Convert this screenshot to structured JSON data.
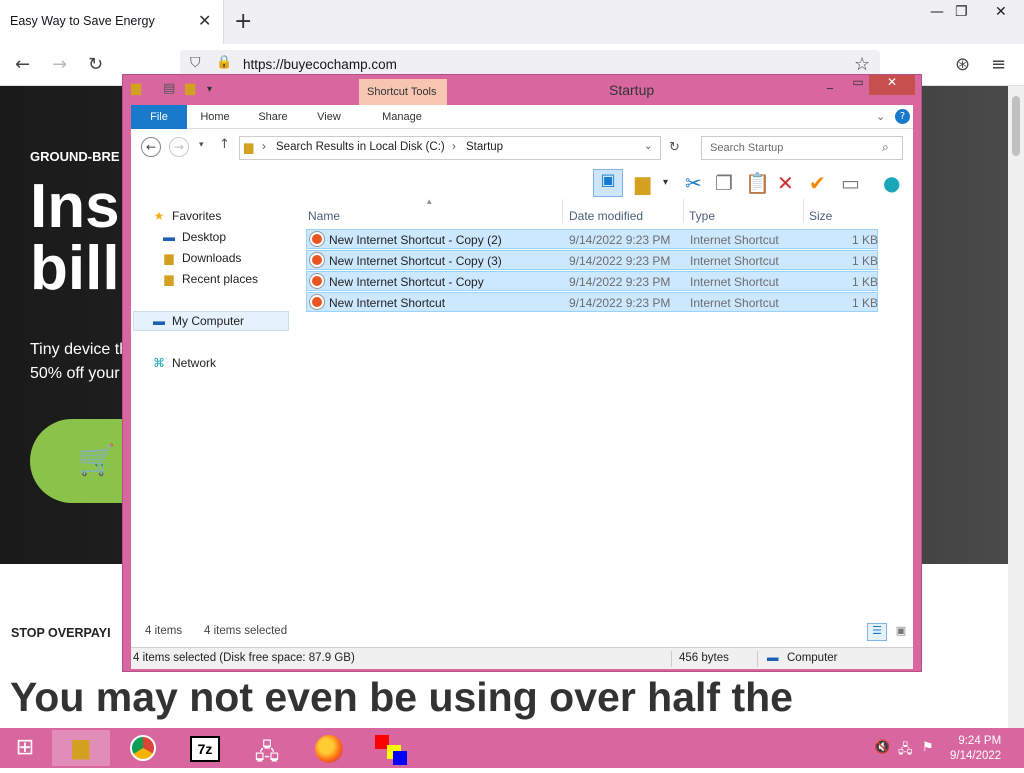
{
  "browser": {
    "tab_title": "Easy Way to Save Energy",
    "tab_close": "✕",
    "new_tab": "+",
    "url": "https://buyecochamp.com",
    "back": "←",
    "forward": "→",
    "reload": "↻",
    "star": "☆",
    "pocket": "⊛",
    "menu": "≡",
    "win_min": "—",
    "win_max": "❐",
    "win_close": "✕"
  },
  "page": {
    "eyebrow": "GROUND-BRE",
    "hero_line1": "Ins",
    "hero_line2": "bill",
    "sub_line1": "Tiny device th",
    "sub_line2": "50% off your",
    "cart": "🛒",
    "stop": "STOP OVERPAYI",
    "big": "You may not even be using over half the"
  },
  "explorer": {
    "title": "Startup",
    "context_tab": "Shortcut Tools",
    "ribbon_tabs": [
      "File",
      "Home",
      "Share",
      "View",
      "Manage"
    ],
    "address": {
      "root": "Search Results in Local Disk (C:)",
      "current": "Startup",
      "sep": "›"
    },
    "search_placeholder": "Search Startup",
    "nav_pane": {
      "favorites": "Favorites",
      "desktop": "Desktop",
      "downloads": "Downloads",
      "recent": "Recent places",
      "computer": "My Computer",
      "network": "Network"
    },
    "columns": [
      "Name",
      "Date modified",
      "Type",
      "Size"
    ],
    "files": [
      {
        "name": "New Internet Shortcut - Copy (2)",
        "date": "9/14/2022 9:23 PM",
        "type": "Internet Shortcut",
        "size": "1 KB"
      },
      {
        "name": "New Internet Shortcut - Copy (3)",
        "date": "9/14/2022 9:23 PM",
        "type": "Internet Shortcut",
        "size": "1 KB"
      },
      {
        "name": "New Internet Shortcut - Copy",
        "date": "9/14/2022 9:23 PM",
        "type": "Internet Shortcut",
        "size": "1 KB"
      },
      {
        "name": "New Internet Shortcut",
        "date": "9/14/2022 9:23 PM",
        "type": "Internet Shortcut",
        "size": "1 KB"
      }
    ],
    "count": "4 items",
    "selected": "4 items selected",
    "status_left": "4 items selected (Disk free space: 87.9 GB)",
    "status_size": "456 bytes",
    "status_location": "Computer"
  },
  "taskbar": {
    "time": "9:24 PM",
    "date": "9/14/2022",
    "sevenzip": "7z"
  }
}
